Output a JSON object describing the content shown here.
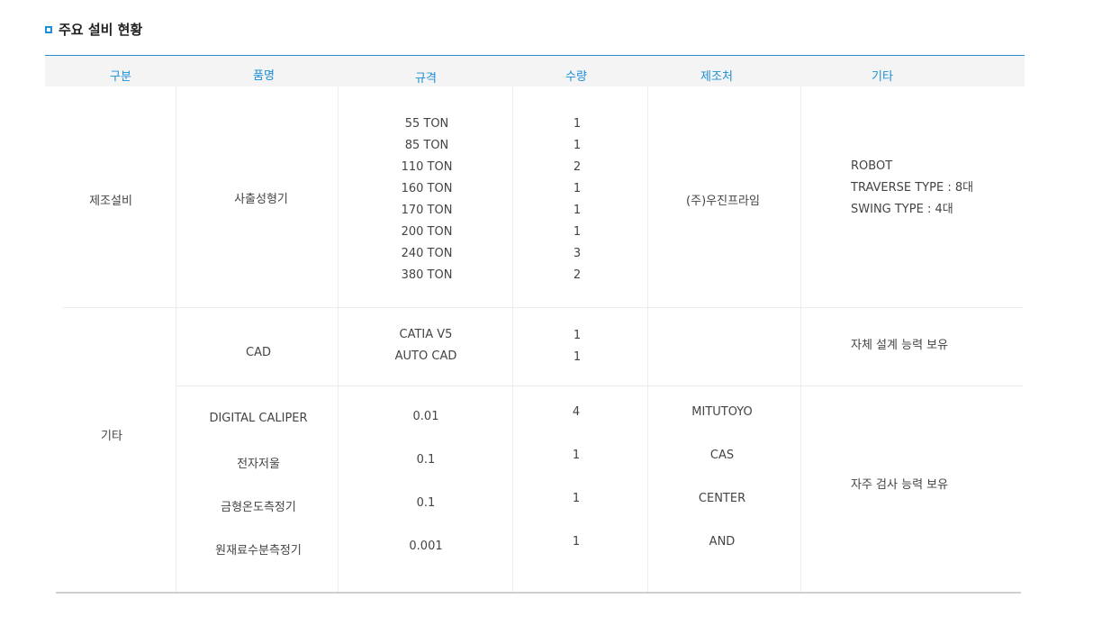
{
  "section": {
    "title": "주요 설비 현황"
  },
  "headers": [
    "구분",
    "품명",
    "규격",
    "수량",
    "제조처",
    "기타"
  ],
  "rows": {
    "manufacturing": {
      "category": "제조설비",
      "item": "사출성형기",
      "specs": [
        "55 TON",
        "85 TON",
        "110 TON",
        "160 TON",
        "170 TON",
        "200 TON",
        "240 TON",
        "380 TON"
      ],
      "quantities": [
        "1",
        "1",
        "2",
        "1",
        "1",
        "1",
        "3",
        "2"
      ],
      "maker": "(주)우진프라임",
      "notes": [
        "ROBOT",
        "TRAVERSE TYPE : 8대",
        "SWING TYPE : 4대"
      ]
    },
    "other": {
      "category": "기타",
      "cad": {
        "item": "CAD",
        "specs": [
          "CATIA V5",
          "AUTO CAD"
        ],
        "quantities": [
          "1",
          "1"
        ],
        "note": "자체 설계 능력 보유"
      },
      "inspection": {
        "items": [
          "DIGITAL CALIPER",
          "전자저울",
          "금형온도측정기",
          "원재료수분측정기"
        ],
        "specs": [
          "0.01",
          "0.1",
          "0.1",
          "0.001"
        ],
        "quantities": [
          "4",
          "1",
          "1",
          "1"
        ],
        "makers": [
          "MITUTOYO",
          "CAS",
          "CENTER",
          "AND"
        ],
        "note": "자주 검사 능력 보유"
      }
    }
  }
}
